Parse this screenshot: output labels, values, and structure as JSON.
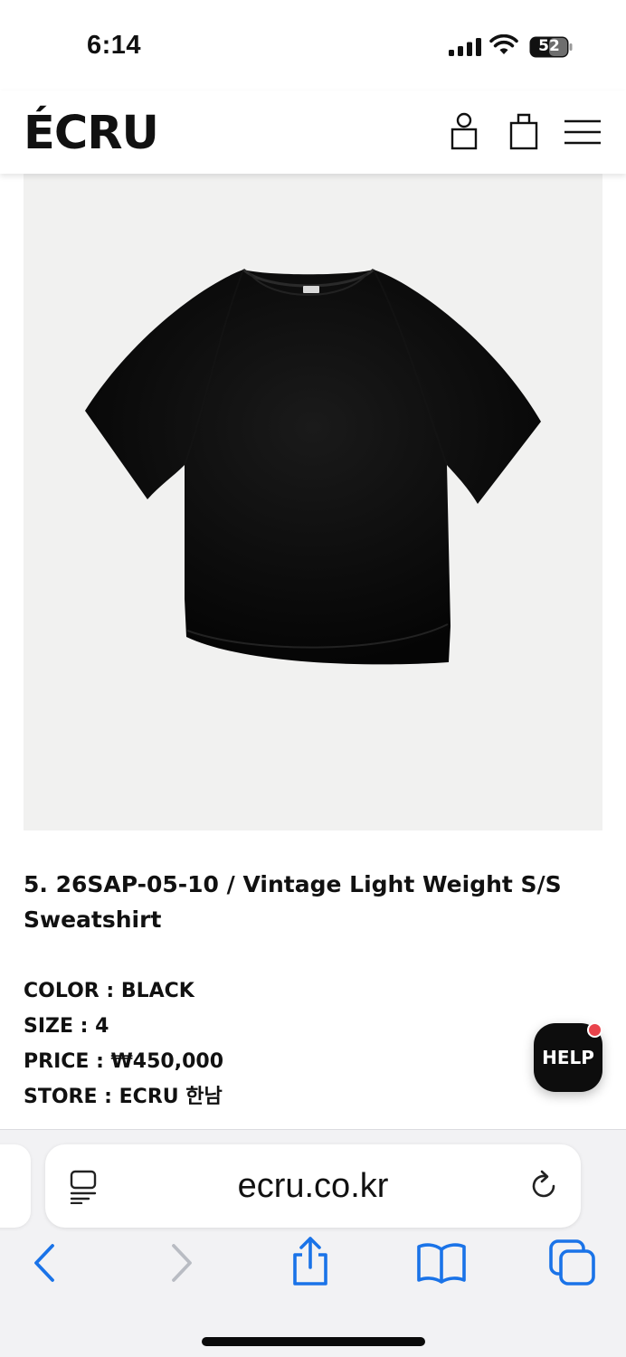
{
  "status_bar": {
    "time": "6:14",
    "battery_level": "52"
  },
  "header": {
    "logo": "ÉCRU",
    "icons": [
      "account-icon",
      "cart-icon",
      "menu-icon"
    ]
  },
  "product": {
    "title": "5. 26SAP-05-10 / Vintage Light Weight S/S Sweatshirt",
    "specs": [
      "COLOR : BLACK",
      "SIZE : 4",
      "PRICE : ₩450,000",
      "STORE : ECRU 한남"
    ],
    "image_subject": "black short-sleeve sweatshirt"
  },
  "help_button": {
    "label": "HELP",
    "badge_color": "#e9434b"
  },
  "browser": {
    "url": "ecru.co.kr",
    "accent_color": "#1a73e8",
    "toolbar": [
      "back",
      "forward",
      "share",
      "bookmarks",
      "tabs"
    ]
  }
}
